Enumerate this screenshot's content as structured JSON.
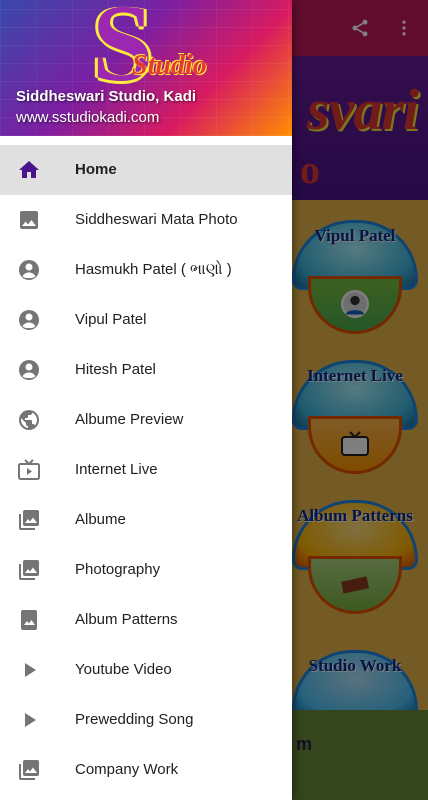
{
  "app": {
    "banner_text": "svari",
    "banner_sub": "o",
    "footer_text": "m",
    "cards": [
      {
        "label": "Vipul Patel",
        "icon": "person-photo-icon"
      },
      {
        "label": "Internet Live",
        "icon": "tv-live-icon"
      },
      {
        "label": "Album Patterns",
        "icon": "album-icon"
      },
      {
        "label": "Studio Work",
        "icon": ""
      }
    ],
    "toolbar": {
      "share_icon": "share-icon",
      "more_icon": "more-vert-icon"
    }
  },
  "drawer": {
    "header": {
      "logo_letter": "S",
      "logo_word": "Studio",
      "title": "Siddheswari Studio, Kadi",
      "subtitle": "www.sstudiokadi.com"
    },
    "items": [
      {
        "label": "Home",
        "icon": "home-icon",
        "selected": true
      },
      {
        "label": "Siddheswari Mata Photo",
        "icon": "image-icon"
      },
      {
        "label": "Hasmukh Patel ( ભાણો )",
        "icon": "account-circle-icon"
      },
      {
        "label": "Vipul Patel",
        "icon": "account-circle-icon"
      },
      {
        "label": "Hitesh Patel",
        "icon": "account-circle-icon"
      },
      {
        "label": "Albume Preview",
        "icon": "globe-icon"
      },
      {
        "label": "Internet Live",
        "icon": "live-tv-icon"
      },
      {
        "label": "Albume",
        "icon": "photo-library-icon"
      },
      {
        "label": "Photography",
        "icon": "photo-library-icon"
      },
      {
        "label": "Album Patterns",
        "icon": "portrait-image-icon"
      },
      {
        "label": "Youtube Video",
        "icon": "play-arrow-icon"
      },
      {
        "label": "Prewedding Song",
        "icon": "play-arrow-icon"
      },
      {
        "label": "Company Work",
        "icon": "photo-library-icon"
      }
    ],
    "colors": {
      "selected_icon": "#4a148c",
      "icon": "#757575",
      "selected_bg": "#e0e0e0"
    }
  }
}
